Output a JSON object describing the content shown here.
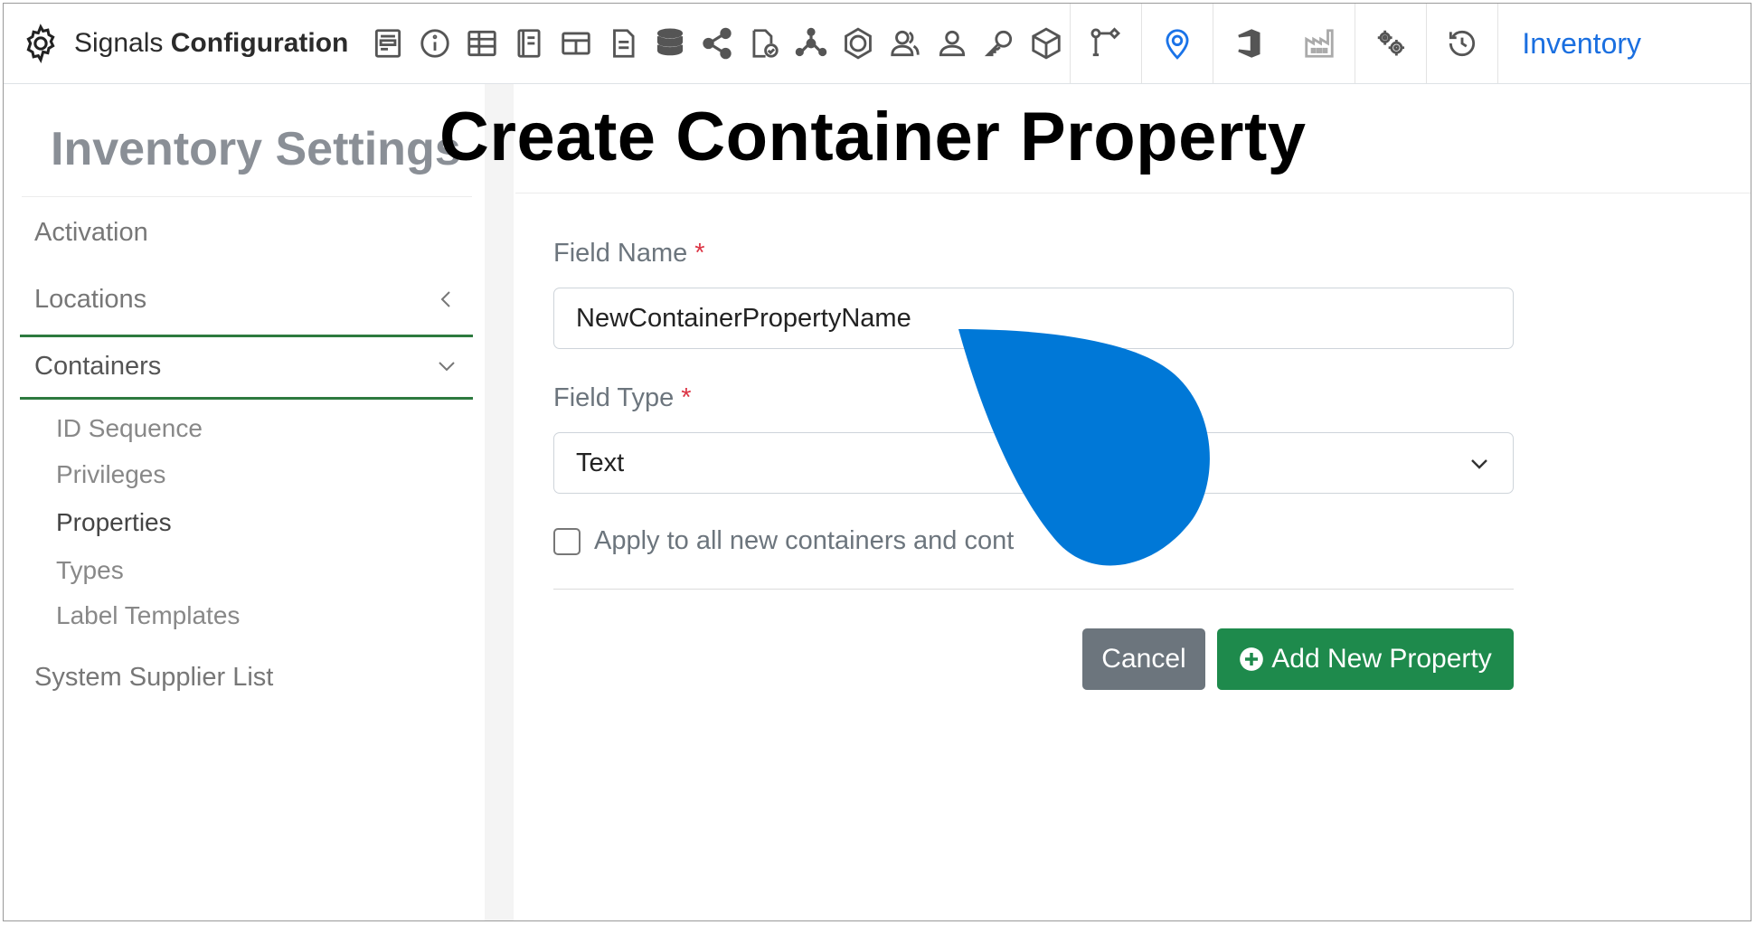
{
  "navbar": {
    "brand_regular": "Signals",
    "brand_bold": "Configuration",
    "link_label": "Inventory"
  },
  "sidebar": {
    "title": "Inventory Settings",
    "items": [
      {
        "label": "Activation"
      },
      {
        "label": "Locations"
      },
      {
        "label": "Containers"
      },
      {
        "label": "System Supplier List"
      }
    ],
    "sub_items": [
      {
        "label": "ID Sequence"
      },
      {
        "label": "Privileges"
      },
      {
        "label": "Properties"
      },
      {
        "label": "Types"
      },
      {
        "label": "Label Templates"
      }
    ]
  },
  "main": {
    "title": "Create Container Property",
    "field_name_label": "Field Name",
    "field_name_value": "NewContainerPropertyName",
    "field_type_label": "Field Type",
    "field_type_value": "Text",
    "required_marker": "*",
    "checkbox_label": "Apply to all new containers and cont",
    "checkbox_checked": false,
    "cancel_label": "Cancel",
    "add_label": "Add New Property"
  },
  "colors": {
    "accent_blue": "#1a6fe0",
    "success_green": "#1e8a4c",
    "secondary_gray": "#6c757d",
    "marker_blue": "#0078d7"
  }
}
